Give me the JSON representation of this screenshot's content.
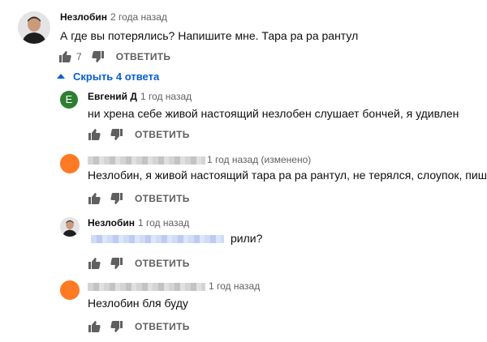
{
  "comments": [
    {
      "author": "Незлобин",
      "time": "2 года назад",
      "text": "А где вы потерялись? Напишите мне. Тара ра ра рантул",
      "likes": "7",
      "reply_label": "ОТВЕТИТЬ"
    }
  ],
  "toggle_replies": {
    "label": "Скрыть 4 ответа"
  },
  "replies": [
    {
      "author": "Евгений Д",
      "avatar_letter": "Е",
      "avatar_color": "#2e7d32",
      "time": "1 год назад",
      "text": "ни хрена себе живой настоящий незлобен слушает бончей, я удивлен",
      "reply_label": "ОТВЕТИТЬ"
    },
    {
      "author": "",
      "avatar_color": "#ff7a22",
      "time": "1 год назад (изменено)",
      "text": "Незлобин, я живой настоящий тара ра ра рантул, не терялся, слоупок, пишу",
      "reply_label": "ОТВЕТИТЬ"
    },
    {
      "author": "Незлобин",
      "time": "1 год назад",
      "text_suffix": "рили?",
      "reply_label": "ОТВЕТИТЬ"
    },
    {
      "author": "",
      "avatar_color": "#ff7a22",
      "time": "1 год назад",
      "text": "Незлобин бля буду",
      "reply_label": "ОТВЕТИТЬ"
    }
  ],
  "colors": {
    "link_blue": "#065fd4",
    "meta_gray": "#606060",
    "text": "#0f0f0f"
  }
}
